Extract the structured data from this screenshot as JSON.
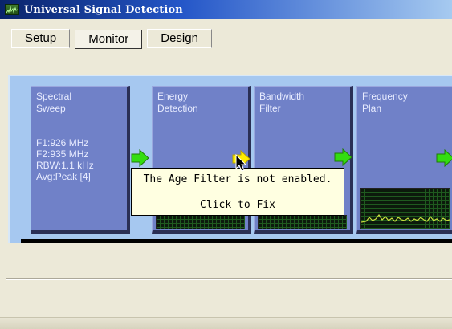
{
  "window": {
    "title": "Universal Signal Detection",
    "icon": "spectrum-app-icon"
  },
  "tabs": [
    {
      "label": "Setup",
      "active": false
    },
    {
      "label": "Monitor",
      "active": true
    },
    {
      "label": "Design",
      "active": false
    }
  ],
  "blocks": [
    {
      "title": "Spectral\nSweep",
      "details": [
        "F1:926 MHz",
        "F2:935 MHz",
        "RBW:1.1 kHz",
        "Avg:Peak [4]"
      ]
    },
    {
      "title": "Energy\nDetection"
    },
    {
      "title": "Bandwidth\nFilter"
    },
    {
      "title": "Frequency\nPlan"
    }
  ],
  "tooltip": {
    "message": "The Age Filter is not enabled.",
    "action": "Click to Fix"
  },
  "colors": {
    "panel": "#a6c8f0",
    "block": "#7081c8",
    "arrow_ok": "#33dd11",
    "arrow_warning": "#ffee00",
    "tooltip_bg": "#ffffe1"
  }
}
